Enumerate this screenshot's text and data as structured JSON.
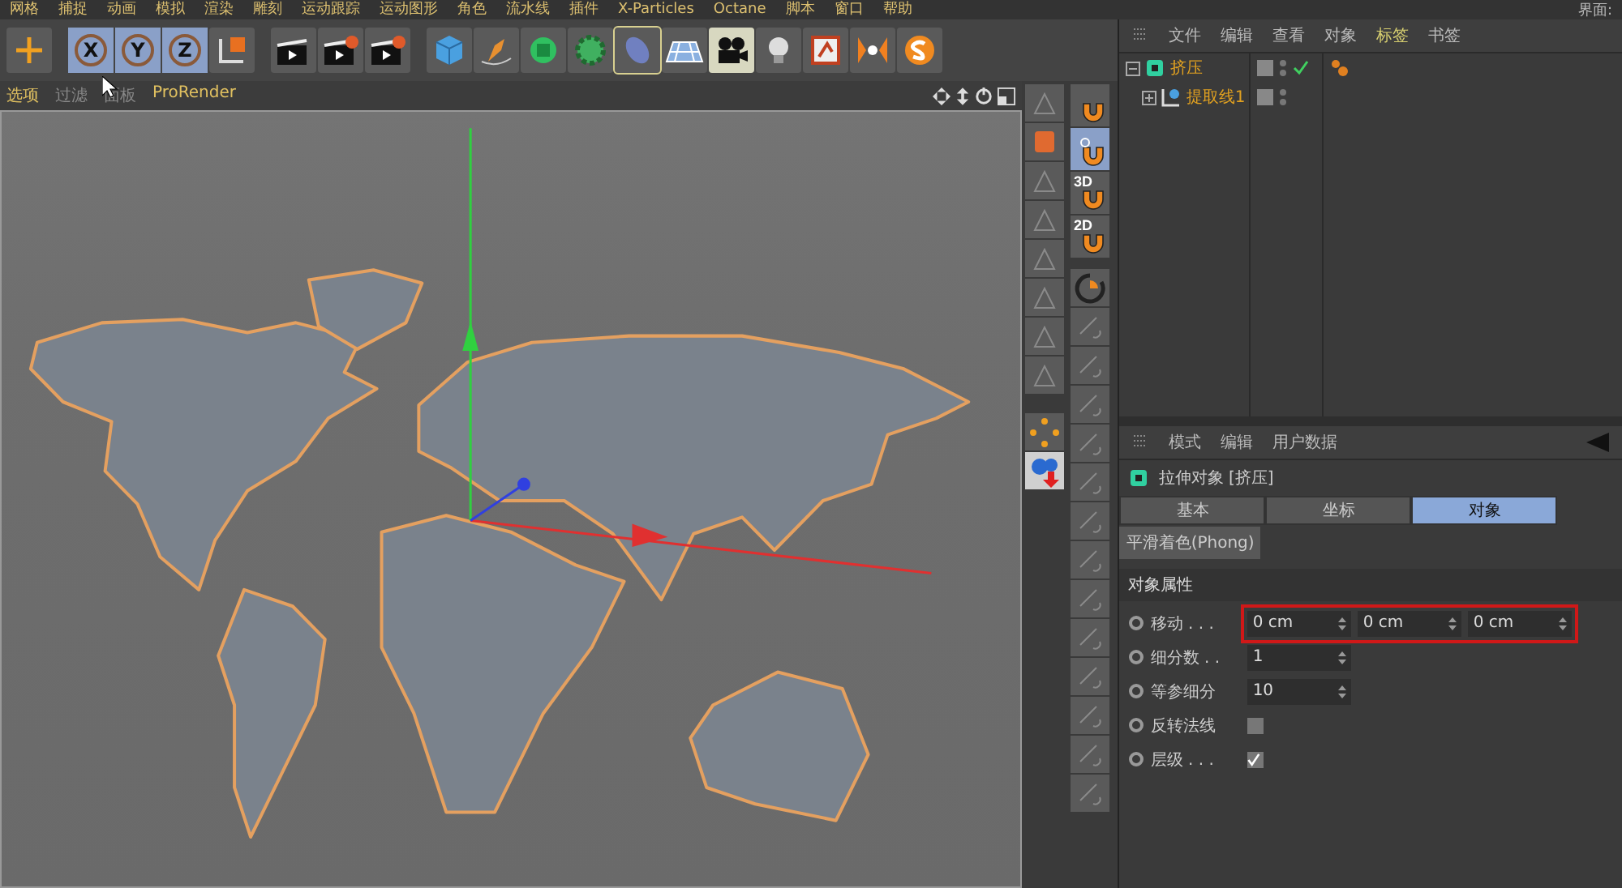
{
  "menu": [
    "网格",
    "捕捉",
    "动画",
    "模拟",
    "渲染",
    "雕刻",
    "运动跟踪",
    "运动图形",
    "角色",
    "流水线",
    "插件",
    "X-Particles",
    "Octane",
    "脚本",
    "窗口",
    "帮助"
  ],
  "layout_label": "界面:",
  "axis_buttons": [
    {
      "label": "X",
      "selected": true
    },
    {
      "label": "Y",
      "selected": true
    },
    {
      "label": "Z",
      "selected": true
    }
  ],
  "viewport": {
    "menu": [
      {
        "label": "选项",
        "highlight": true
      },
      {
        "label": "过滤",
        "highlight": false
      },
      {
        "label": "面板",
        "highlight": false
      },
      {
        "label": "ProRender",
        "highlight": true
      }
    ]
  },
  "snap_buttons": [
    {
      "kind": "magnet",
      "selected": false
    },
    {
      "kind": "auto",
      "selected": true
    },
    {
      "kind": "label",
      "label": "3D",
      "selected": false
    },
    {
      "kind": "label",
      "label": "2D",
      "selected": false
    }
  ],
  "object_manager": {
    "menu": [
      {
        "label": "文件",
        "highlight": false
      },
      {
        "label": "编辑",
        "highlight": false
      },
      {
        "label": "查看",
        "highlight": false
      },
      {
        "label": "对象",
        "highlight": false
      },
      {
        "label": "标签",
        "highlight": true
      },
      {
        "label": "书签",
        "highlight": false
      }
    ],
    "objects": [
      {
        "name": "挤压",
        "kind": "extrude",
        "enabled": true,
        "children": [
          {
            "name": "提取线1",
            "kind": "spline",
            "enabled": false
          }
        ]
      }
    ]
  },
  "attributes": {
    "menu": [
      "模式",
      "编辑",
      "用户数据"
    ],
    "title": "拉伸对象 [挤压]",
    "tabs": [
      {
        "label": "基本",
        "selected": false
      },
      {
        "label": "坐标",
        "selected": false
      },
      {
        "label": "对象",
        "selected": true
      }
    ],
    "chip": "平滑着色(Phong)",
    "section": "对象属性",
    "fields": [
      {
        "kind": "vector",
        "label": "移动 . . .",
        "values": [
          "0 cm",
          "0 cm",
          "0 cm"
        ],
        "highlighted": true
      },
      {
        "kind": "number",
        "label": "细分数 . .",
        "value": "1",
        "highlighted": false
      },
      {
        "kind": "number",
        "label": "等参细分",
        "value": "10",
        "highlighted": false
      },
      {
        "kind": "checkbox",
        "label": "反转法线",
        "checked": false,
        "highlighted": false
      },
      {
        "kind": "checkbox",
        "label": "层级 . . .",
        "checked": true,
        "highlighted": false
      }
    ]
  }
}
